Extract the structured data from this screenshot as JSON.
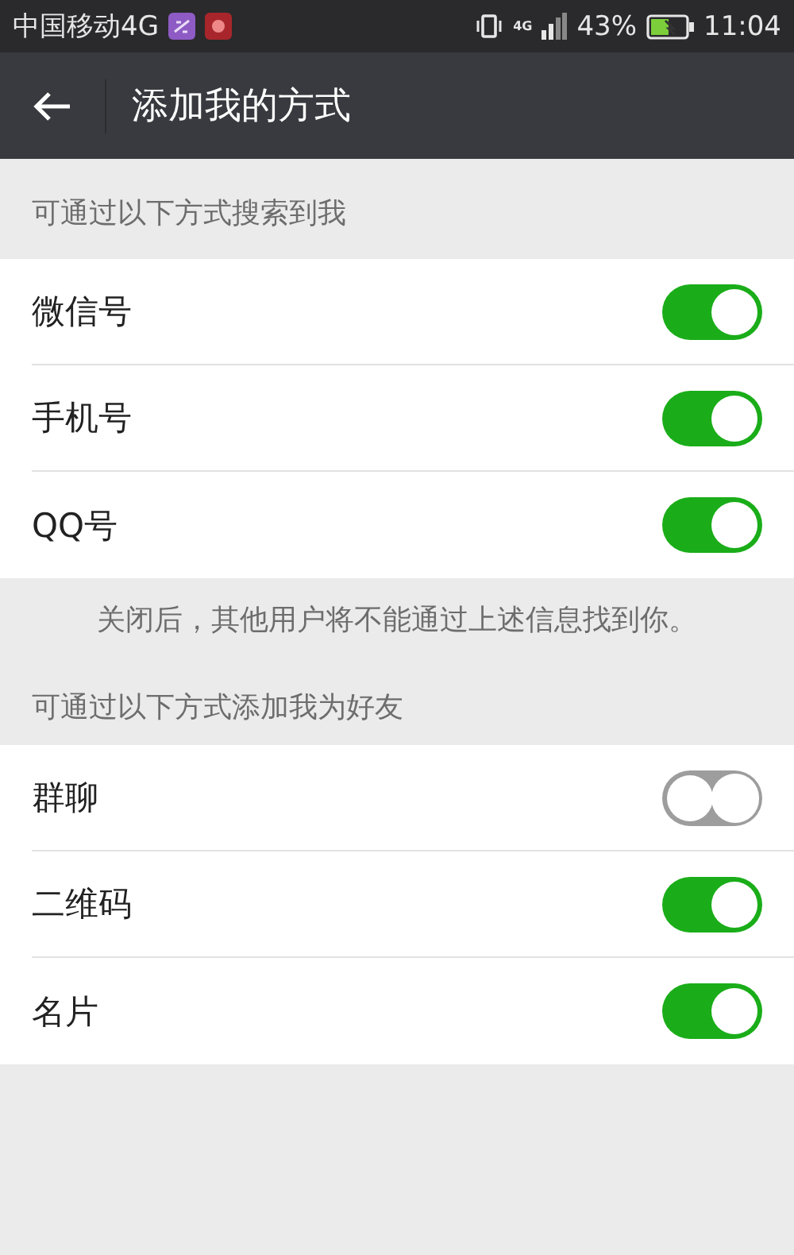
{
  "status_bar": {
    "carrier": "中国移动4G",
    "network_type": "4G",
    "battery": "43%",
    "time": "11:04"
  },
  "header": {
    "title": "添加我的方式"
  },
  "sections": [
    {
      "title": "可通过以下方式搜索到我",
      "items": [
        {
          "label": "微信号",
          "on": true
        },
        {
          "label": "手机号",
          "on": true
        },
        {
          "label": "QQ号",
          "on": true
        }
      ],
      "note": "关闭后，其他用户将不能通过上述信息找到你。"
    },
    {
      "title": "可通过以下方式添加我为好友",
      "items": [
        {
          "label": "群聊",
          "on": false
        },
        {
          "label": "二维码",
          "on": true
        },
        {
          "label": "名片",
          "on": true
        }
      ]
    }
  ]
}
